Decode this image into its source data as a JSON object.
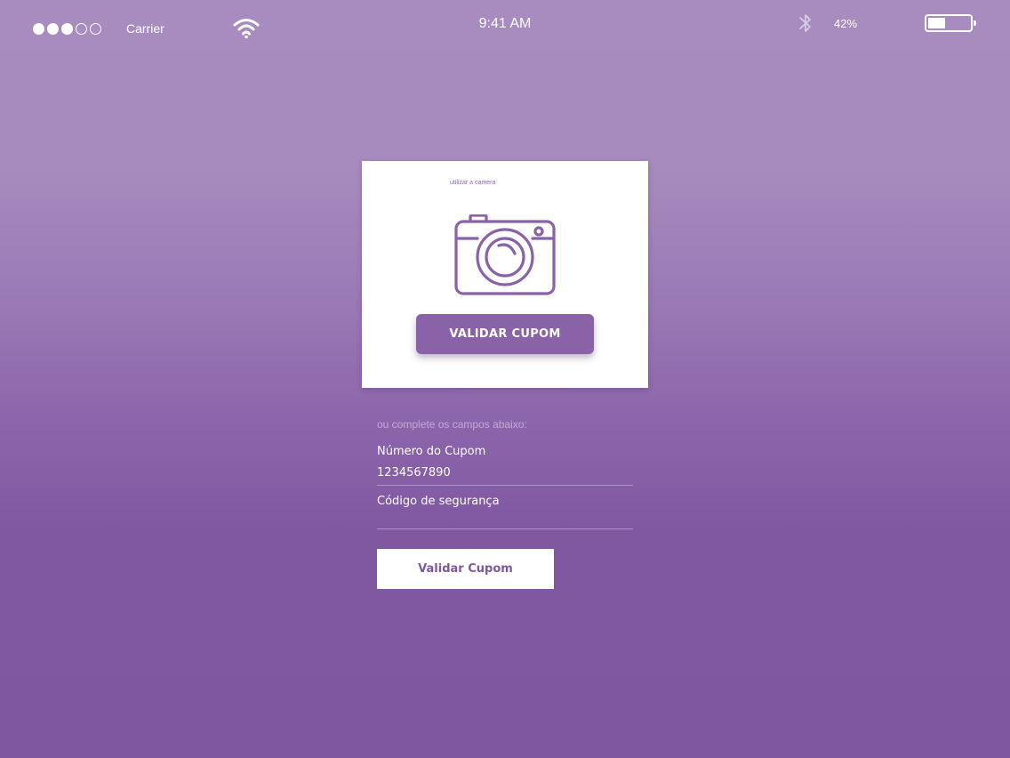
{
  "status_bar": {
    "signal_dots": {
      "filled": 3,
      "total": 5
    },
    "carrier": "Carrier",
    "time": "9:41 AM",
    "battery_percent_label": "42%",
    "battery_level": 0.42,
    "icons": [
      "wifi-icon",
      "bluetooth-icon",
      "battery-icon"
    ]
  },
  "camera_card": {
    "caption": "utilizar a camera",
    "icon": "camera-icon",
    "button_label": "VALIDAR CUPOM"
  },
  "form": {
    "hint": "ou complete os campos abaixo:",
    "coupon_number": {
      "label": "Número do Cupom",
      "value": "1234567890"
    },
    "security_code": {
      "label": "Código de segurança",
      "value": ""
    },
    "submit_label": "Validar Cupom"
  },
  "colors": {
    "accent": "#8a62a7",
    "background_top": "#a88bbf",
    "background_bottom": "#7f57a1",
    "card": "#ffffff"
  }
}
